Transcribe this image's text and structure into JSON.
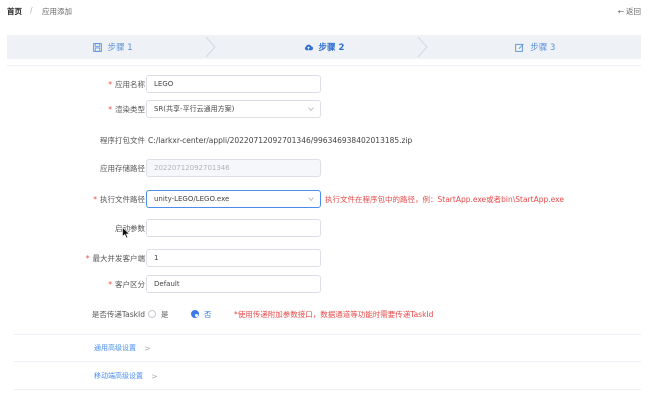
{
  "breadcrumb": {
    "home": "首页",
    "separator": "/",
    "current": "应用添加"
  },
  "back": {
    "icon": "←",
    "label": "返回"
  },
  "steps": [
    {
      "icon": "save-icon",
      "label": "步骤 1"
    },
    {
      "icon": "cloud-upload-icon",
      "label": "步骤 2"
    },
    {
      "icon": "edit-icon",
      "label": "步骤 3"
    }
  ],
  "form": {
    "app_name": {
      "label": "应用名称",
      "value": "LEGO"
    },
    "render_type": {
      "label": "渲染类型",
      "value": "SR(共享-平行云通用方案)"
    },
    "package_file": {
      "label": "程序打包文件",
      "value": "C:/larkxr-center/appli/20220712092701346/996346938402013185.zip"
    },
    "storage_path": {
      "label": "应用存储路径",
      "value": "20220712092701346"
    },
    "exec_path": {
      "label": "执行文件路径",
      "value": "unity-LEGO/LEGO.exe",
      "hint": "执行文件在程序包中的路径，例：StartApp.exe或者bin\\StartApp.exe"
    },
    "launch_params": {
      "label": "启动参数",
      "value": ""
    },
    "max_clients": {
      "label": "最大并发客户端",
      "value": "1"
    },
    "client_zone": {
      "label": "客户区分",
      "value": "Default"
    },
    "task_id": {
      "label": "是否传递TaskId",
      "option_yes": "是",
      "option_no": "否",
      "selected": "否",
      "hint": "*使用传递附加参数接口，数据通道等功能时需要传递TaskId"
    }
  },
  "sections": {
    "general": "通用高级设置",
    "mobile": "移动端高级设置",
    "arrow": ">"
  },
  "colors": {
    "accent": "#3a7be8",
    "required": "#e84a4a",
    "stepbar_bg": "#eef2f7"
  }
}
